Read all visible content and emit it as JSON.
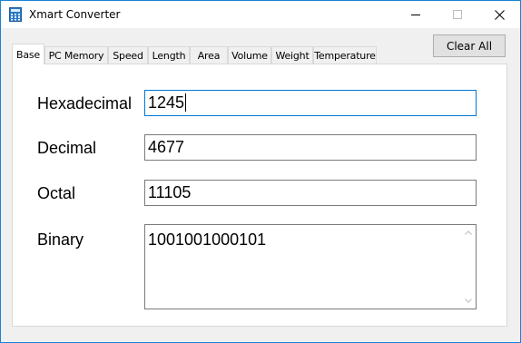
{
  "window": {
    "title": "Xmart Converter"
  },
  "toolbar": {
    "clear_all_label": "Clear All"
  },
  "tabs": [
    {
      "label": "Base"
    },
    {
      "label": "PC Memory"
    },
    {
      "label": "Speed"
    },
    {
      "label": "Length"
    },
    {
      "label": "Area"
    },
    {
      "label": "Volume"
    },
    {
      "label": "Weight"
    },
    {
      "label": "Temperature"
    }
  ],
  "active_tab": "Base",
  "fields": {
    "hexadecimal": {
      "label": "Hexadecimal",
      "value": "1245"
    },
    "decimal": {
      "label": "Decimal",
      "value": "4677"
    },
    "octal": {
      "label": "Octal",
      "value": "11105"
    },
    "binary": {
      "label": "Binary",
      "value": "1001001000101"
    }
  },
  "colors": {
    "accent": "#0078d7",
    "window_border": "#1883d7",
    "button_bg": "#e1e1e1"
  }
}
